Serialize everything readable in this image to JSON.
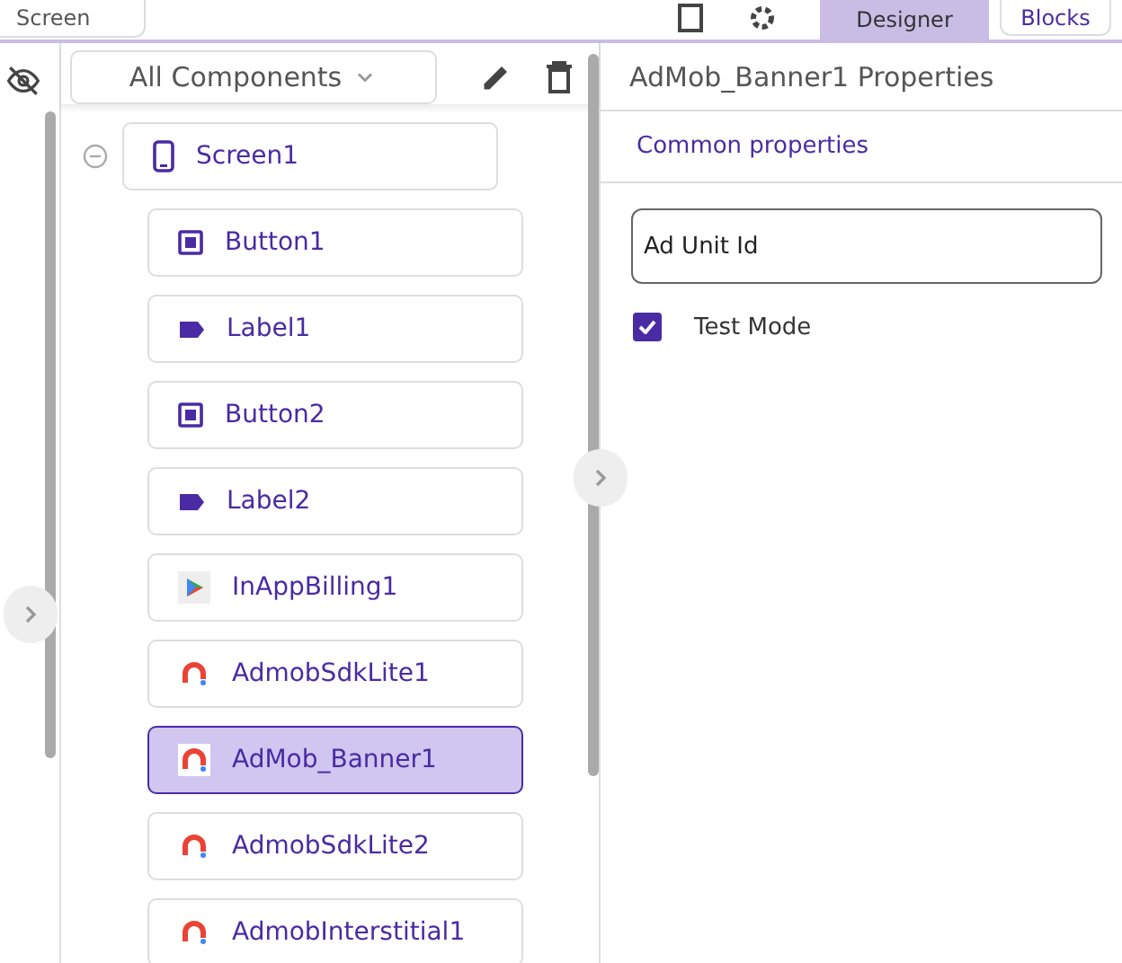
{
  "top_bar": {
    "screen_selector": "Screen",
    "tabs": [
      {
        "label": "Designer",
        "selected": true
      },
      {
        "label": "Blocks",
        "selected": false
      }
    ]
  },
  "components_panel": {
    "filter": "All Components",
    "tree": [
      {
        "label": "Screen1",
        "kind": "screen",
        "selected": false,
        "expanded": true,
        "children": [
          {
            "label": "Button1",
            "kind": "button",
            "selected": false
          },
          {
            "label": "Label1",
            "kind": "label",
            "selected": false
          },
          {
            "label": "Button2",
            "kind": "button",
            "selected": false
          },
          {
            "label": "Label2",
            "kind": "label",
            "selected": false
          },
          {
            "label": "InAppBilling1",
            "kind": "billing",
            "selected": false
          },
          {
            "label": "AdmobSdkLite1",
            "kind": "admob",
            "selected": false
          },
          {
            "label": "AdMob_Banner1",
            "kind": "admob",
            "selected": true
          },
          {
            "label": "AdmobSdkLite2",
            "kind": "admob",
            "selected": false
          },
          {
            "label": "AdmobInterstitial1",
            "kind": "admob",
            "selected": false
          }
        ]
      }
    ]
  },
  "properties_panel": {
    "title": "AdMob_Banner1 Properties",
    "section": "Common properties",
    "fields": [
      {
        "kind": "text",
        "placeholder": "Ad Unit Id"
      },
      {
        "kind": "checkbox",
        "label": "Test Mode",
        "checked": true
      }
    ]
  }
}
